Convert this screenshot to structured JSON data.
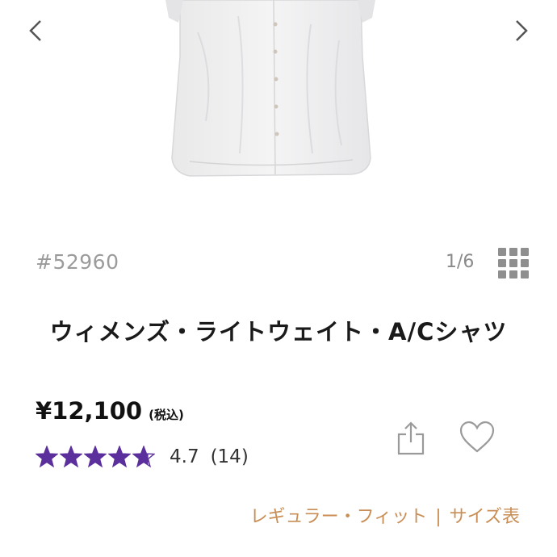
{
  "product": {
    "sku": "#52960",
    "image_counter": "1/6",
    "title": "ウィメンズ・ライトウェイト・A/Cシャツ",
    "price": "¥12,100",
    "tax_note": "(税込)",
    "rating": {
      "value": 4.7,
      "value_text": "4.7",
      "count_text": "(14)",
      "max": 5
    },
    "fit_label": "レギュラー・フィット",
    "size_chart_label": "サイズ表"
  },
  "icons": {
    "prev": "chevron-left-icon",
    "next": "chevron-right-icon",
    "grid": "grid-icon",
    "share": "share-icon",
    "favorite": "heart-icon",
    "star": "star-icon"
  },
  "colors": {
    "star_fill": "#5b2f9c",
    "link": "#c98e55",
    "muted": "#9b9b9b"
  }
}
